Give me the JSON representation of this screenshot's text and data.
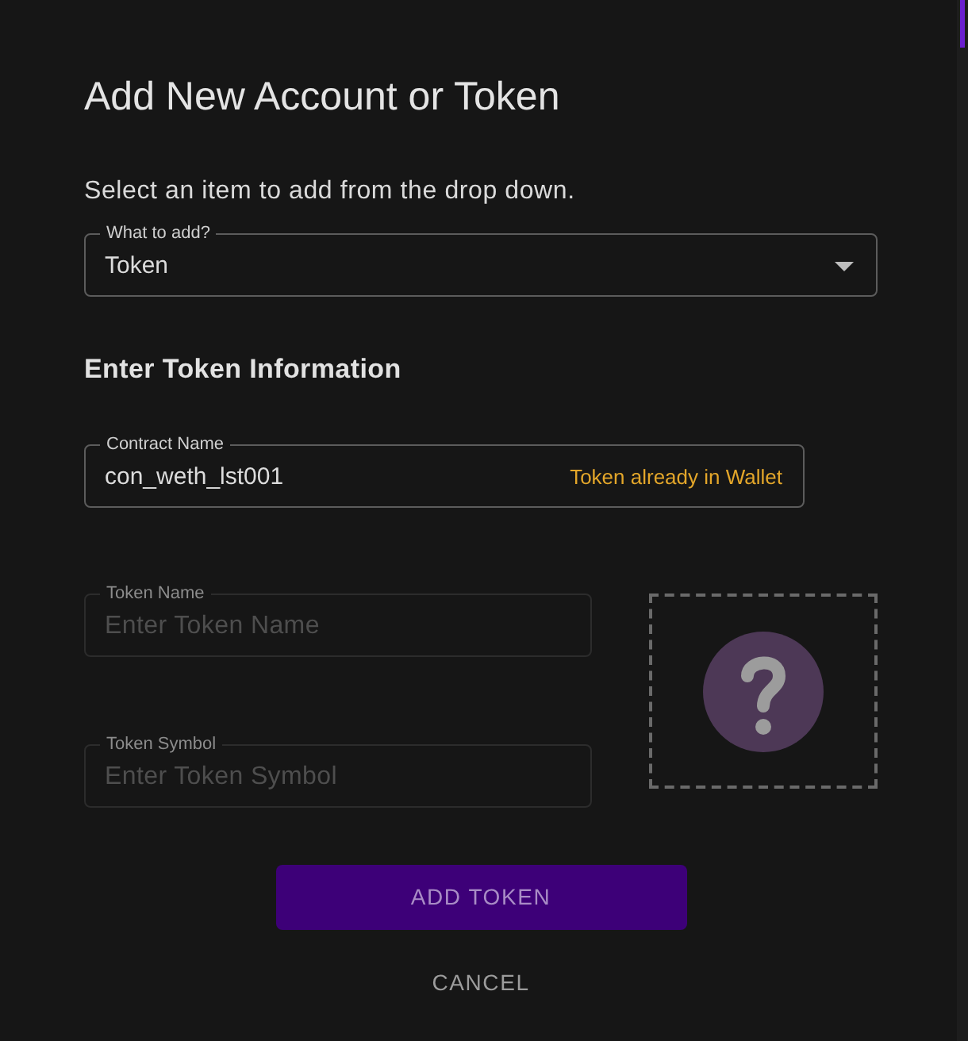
{
  "dialog": {
    "title": "Add New Account or Token",
    "instruction": "Select an item to add from the drop down."
  },
  "select": {
    "label": "What to add?",
    "value": "Token"
  },
  "section_title": "Enter Token Information",
  "contract_field": {
    "label": "Contract Name",
    "value": "con_weth_lst001",
    "status": "Token already in Wallet",
    "disabled": false
  },
  "token_fields": [
    {
      "label": "Token Name",
      "placeholder": "Enter Token Name",
      "disabled": true
    },
    {
      "label": "Token Symbol",
      "placeholder": "Enter Token Symbol",
      "disabled": true
    }
  ],
  "buttons": [
    {
      "label": "ADD TOKEN",
      "kind": "primary"
    },
    {
      "label": "CANCEL",
      "kind": "text"
    }
  ]
}
